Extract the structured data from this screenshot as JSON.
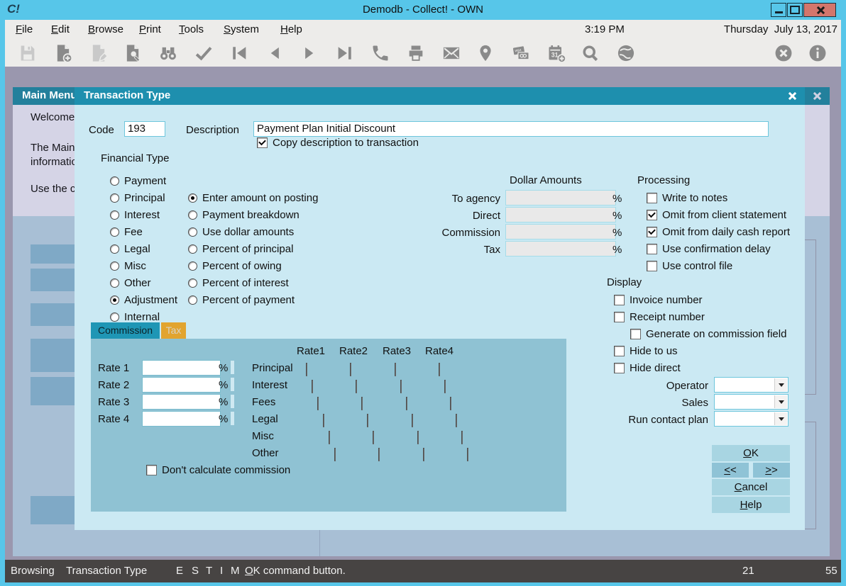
{
  "titlebar": {
    "logo": "C!",
    "title": "Demodb - Collect! - OWN"
  },
  "menubar": {
    "items": [
      "File",
      "Edit",
      "Browse",
      "Print",
      "Tools",
      "System",
      "Help"
    ],
    "time": "3:19 PM",
    "date": "Thursday  July 13, 2017"
  },
  "toolbar": {
    "icons": [
      "save",
      "new-document",
      "edit-document",
      "find-document",
      "binoculars",
      "confirm",
      "first-record",
      "previous-record",
      "next-record",
      "last-record",
      "phone",
      "print",
      "email",
      "map-pin",
      "credit-card",
      "calendar-add",
      "search",
      "globe",
      "close-circle",
      "info-circle"
    ]
  },
  "main_menu_window": {
    "title": "Main Menu",
    "text_lines": [
      "Welcome",
      "The Main",
      "informatic",
      "Use the c"
    ]
  },
  "dialog": {
    "title": "Transaction Type",
    "code_label": "Code",
    "code_value": "193",
    "description_label": "Description",
    "description_value": "Payment Plan Initial Discount",
    "copy_description": {
      "label": "Copy description to transaction",
      "checked": true
    },
    "financial_type": {
      "header": "Financial Type",
      "options": [
        {
          "label": "Payment",
          "selected": false
        },
        {
          "label": "Principal",
          "selected": false
        },
        {
          "label": "Interest",
          "selected": false
        },
        {
          "label": "Fee",
          "selected": false
        },
        {
          "label": "Legal",
          "selected": false
        },
        {
          "label": "Misc",
          "selected": false
        },
        {
          "label": "Other",
          "selected": false
        },
        {
          "label": "Adjustment",
          "selected": true
        },
        {
          "label": "Internal",
          "selected": false
        }
      ]
    },
    "posting_options": [
      {
        "label": "Enter amount on posting",
        "selected": true
      },
      {
        "label": "Payment breakdown",
        "selected": false
      },
      {
        "label": "Use dollar amounts",
        "selected": false
      },
      {
        "label": "Percent of principal",
        "selected": false
      },
      {
        "label": "Percent of owing",
        "selected": false
      },
      {
        "label": "Percent of interest",
        "selected": false
      },
      {
        "label": "Percent of payment",
        "selected": false
      }
    ],
    "dollar_amounts": {
      "header": "Dollar Amounts",
      "percent": "%",
      "rows": [
        {
          "label": "To agency",
          "value": ""
        },
        {
          "label": "Direct",
          "value": ""
        },
        {
          "label": "Commission",
          "value": ""
        },
        {
          "label": "Tax",
          "value": ""
        }
      ]
    },
    "processing": {
      "header": "Processing",
      "items": [
        {
          "label": "Write to notes",
          "checked": false
        },
        {
          "label": "Omit from client statement",
          "checked": true
        },
        {
          "label": "Omit from daily cash report",
          "checked": true
        },
        {
          "label": "Use confirmation delay",
          "checked": false
        },
        {
          "label": "Use control file",
          "checked": false
        }
      ]
    },
    "display": {
      "header": "Display",
      "items": [
        {
          "label": "Invoice number",
          "checked": false
        },
        {
          "label": "Receipt number",
          "checked": false
        },
        {
          "label": "Generate on commission field",
          "checked": false
        },
        {
          "label": "Hide to us",
          "checked": false
        },
        {
          "label": "Hide direct",
          "checked": false
        }
      ],
      "combos": [
        {
          "label": "Operator",
          "value": ""
        },
        {
          "label": "Sales",
          "value": ""
        },
        {
          "label": "Run contact plan",
          "value": ""
        }
      ]
    },
    "tabs": [
      {
        "label": "Commission",
        "active": true
      },
      {
        "label": "Tax",
        "active": false
      }
    ],
    "commission_panel": {
      "percent": "%",
      "rates": [
        {
          "label": "Rate 1",
          "value": ""
        },
        {
          "label": "Rate 2",
          "value": ""
        },
        {
          "label": "Rate 3",
          "value": ""
        },
        {
          "label": "Rate 4",
          "value": ""
        }
      ],
      "grid_columns": [
        "Rate1",
        "Rate2",
        "Rate3",
        "Rate4"
      ],
      "grid_rows": [
        "Principal",
        "Interest",
        "Fees",
        "Legal",
        "Misc",
        "Other"
      ],
      "dont_calculate": {
        "label": "Don't calculate commission",
        "checked": false
      }
    },
    "buttons": [
      {
        "label": "OK"
      },
      {
        "label": "<<"
      },
      {
        "label": ">>"
      },
      {
        "label": "Cancel"
      },
      {
        "label": "Help"
      }
    ]
  },
  "statusbar": {
    "mode": "Browsing",
    "context": "Transaction Type",
    "flags": [
      "E",
      "S",
      "T",
      "I",
      "M"
    ],
    "message": "OK command button.",
    "value_left": "21",
    "value_right": "55"
  },
  "colors": {
    "frame": "#57c6e9",
    "dialog_title": "#1e8fae",
    "dialog_body": "#cbe9f3",
    "panel": "#8fc2d3",
    "tab_active": "#1f96b5",
    "tab_tax": "#e2a42f",
    "mdi_background": "#9a97ae",
    "statusbar": "#474443",
    "close_button": "#d3766c"
  }
}
